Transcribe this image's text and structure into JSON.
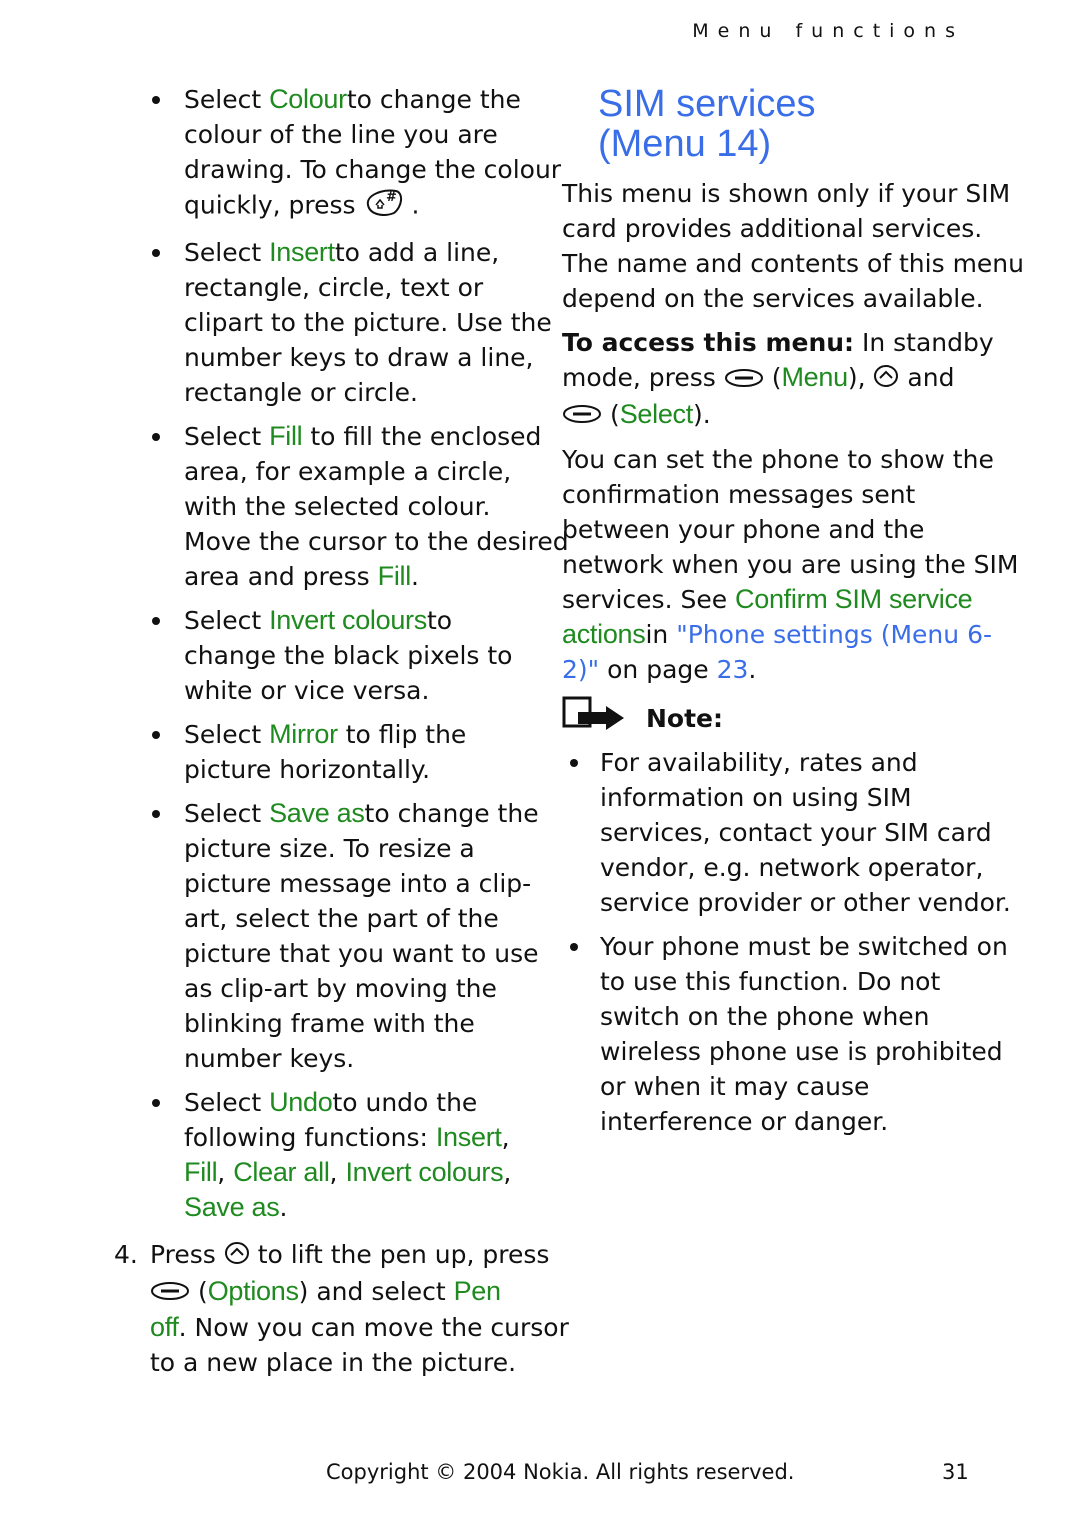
{
  "header": {
    "section": "Menu functions"
  },
  "left": {
    "bullets": [
      {
        "lines": [
          [
            {
              "t": "Select "
            },
            {
              "g": "Colour"
            },
            {
              "t": "to change the"
            }
          ],
          [
            {
              "t": "colour of the line you are"
            }
          ],
          [
            {
              "t": "drawing. To change the colour"
            }
          ],
          [
            {
              "t": "quickly, press  "
            },
            {
              "icon": "hash-key"
            },
            {
              "t": " ."
            }
          ]
        ]
      },
      {
        "lines": [
          [
            {
              "t": "Select "
            },
            {
              "g": "Insert"
            },
            {
              "t": "to add a line,"
            }
          ],
          [
            {
              "t": "rectangle, circle, text or"
            }
          ],
          [
            {
              "t": "clipart to the picture. Use the"
            }
          ],
          [
            {
              "t": "number keys to draw a line,"
            }
          ],
          [
            {
              "t": "rectangle or circle."
            }
          ]
        ]
      },
      {
        "lines": [
          [
            {
              "t": "Select "
            },
            {
              "g": "Fill"
            },
            {
              "t": " to fill the enclosed"
            }
          ],
          [
            {
              "t": "area, for example a circle,"
            }
          ],
          [
            {
              "t": "with the selected colour."
            }
          ],
          [
            {
              "t": "Move the cursor to the desired"
            }
          ],
          [
            {
              "t": "area and press "
            },
            {
              "g": "Fill"
            },
            {
              "t": "."
            }
          ]
        ]
      },
      {
        "lines": [
          [
            {
              "t": "Select "
            },
            {
              "g": "Invert colours"
            },
            {
              "t": "to"
            }
          ],
          [
            {
              "t": "change the black pixels to"
            }
          ],
          [
            {
              "t": "white or vice versa."
            }
          ]
        ]
      },
      {
        "lines": [
          [
            {
              "t": "Select "
            },
            {
              "g": "Mirror"
            },
            {
              "t": " to flip the"
            }
          ],
          [
            {
              "t": "picture horizontally."
            }
          ]
        ]
      },
      {
        "lines": [
          [
            {
              "t": "Select "
            },
            {
              "g": "Save as"
            },
            {
              "t": "to change the"
            }
          ],
          [
            {
              "t": "picture size. To resize a"
            }
          ],
          [
            {
              "t": "picture message into a clip-"
            }
          ],
          [
            {
              "t": "art, select the part of the"
            }
          ],
          [
            {
              "t": "picture that you want to use"
            }
          ],
          [
            {
              "t": "as clip-art by moving the"
            }
          ],
          [
            {
              "t": "blinking frame with the"
            }
          ],
          [
            {
              "t": "number keys."
            }
          ]
        ]
      },
      {
        "lines": [
          [
            {
              "t": "Select "
            },
            {
              "g": "Undo"
            },
            {
              "t": "to undo the"
            }
          ],
          [
            {
              "t": "following functions: "
            },
            {
              "g": "Insert"
            },
            {
              "t": ","
            }
          ],
          [
            {
              "g": "Fill"
            },
            {
              "t": ", "
            },
            {
              "g": "Clear all"
            },
            {
              "t": ", "
            },
            {
              "g": "Invert colours"
            },
            {
              "t": ","
            }
          ],
          [
            {
              "g": "Save as"
            },
            {
              "t": "."
            }
          ]
        ]
      }
    ],
    "step": {
      "number": "4.",
      "lines": [
        [
          {
            "t": "Press "
          },
          {
            "icon": "up-key"
          },
          {
            "t": " to lift the pen up, press"
          }
        ],
        [
          {
            "icon": "softkey"
          },
          {
            "t": " ("
          },
          {
            "g": "Options"
          },
          {
            "t": ") and select "
          },
          {
            "g": "Pen"
          }
        ],
        [
          {
            "g": "off"
          },
          {
            "t": ". Now you can move the cursor"
          }
        ],
        [
          {
            "t": "to a new place in the picture."
          }
        ]
      ]
    }
  },
  "right": {
    "title_line1": "SIM services",
    "title_line2": "(Menu 14)",
    "intro": [
      [
        {
          "t": "This menu is shown only if your SIM"
        }
      ],
      [
        {
          "t": "card provides additional services."
        }
      ],
      [
        {
          "t": "The name and contents of this menu"
        }
      ],
      [
        {
          "t": "depend on the services available."
        }
      ]
    ],
    "access": [
      [
        {
          "bold": "To access this menu:"
        },
        {
          "t": " In standby"
        }
      ],
      [
        {
          "t": "mode, press "
        },
        {
          "icon": "softkey"
        },
        {
          "t": " ("
        },
        {
          "g": "Menu"
        },
        {
          "t": "), "
        },
        {
          "icon": "up-key"
        },
        {
          "t": " and"
        }
      ],
      [
        {
          "icon": "softkey"
        },
        {
          "t": " ("
        },
        {
          "g": "Select"
        },
        {
          "t": ")."
        }
      ]
    ],
    "confirm": [
      [
        {
          "t": "You can set the phone to show the"
        }
      ],
      [
        {
          "t": "confirmation messages sent"
        }
      ],
      [
        {
          "t": "between your phone and the"
        }
      ],
      [
        {
          "t": "network when you are using the SIM"
        }
      ],
      [
        {
          "t": "services. See "
        },
        {
          "g": "Confirm SIM service"
        }
      ],
      [
        {
          "g": "actions"
        },
        {
          "t": "in "
        },
        {
          "b": "\"Phone settings (Menu 6-"
        }
      ],
      [
        {
          "b": "2)\""
        },
        {
          "t": " on page "
        },
        {
          "b": "23"
        },
        {
          "t": "."
        }
      ]
    ],
    "note_label": "Note:",
    "note_bullets": [
      {
        "lines": [
          [
            {
              "t": "For availability, rates and"
            }
          ],
          [
            {
              "t": "information on using SIM"
            }
          ],
          [
            {
              "t": "services, contact your SIM card"
            }
          ],
          [
            {
              "t": "vendor, e.g. network operator,"
            }
          ],
          [
            {
              "t": "service provider or other vendor."
            }
          ]
        ]
      },
      {
        "lines": [
          [
            {
              "t": "Your phone must be switched on"
            }
          ],
          [
            {
              "t": "to use this function. Do not"
            }
          ],
          [
            {
              "t": "switch on the phone when"
            }
          ],
          [
            {
              "t": "wireless phone use is prohibited"
            }
          ],
          [
            {
              "t": "or when it may cause"
            }
          ],
          [
            {
              "t": "interference or danger."
            }
          ]
        ]
      }
    ]
  },
  "footer": {
    "copyright": "Copyright © 2004 Nokia. All rights reserved.",
    "page_number": "31"
  },
  "colors": {
    "menu_term": "#1f8a1f",
    "link": "#3a6ee8",
    "text": "#111111"
  }
}
